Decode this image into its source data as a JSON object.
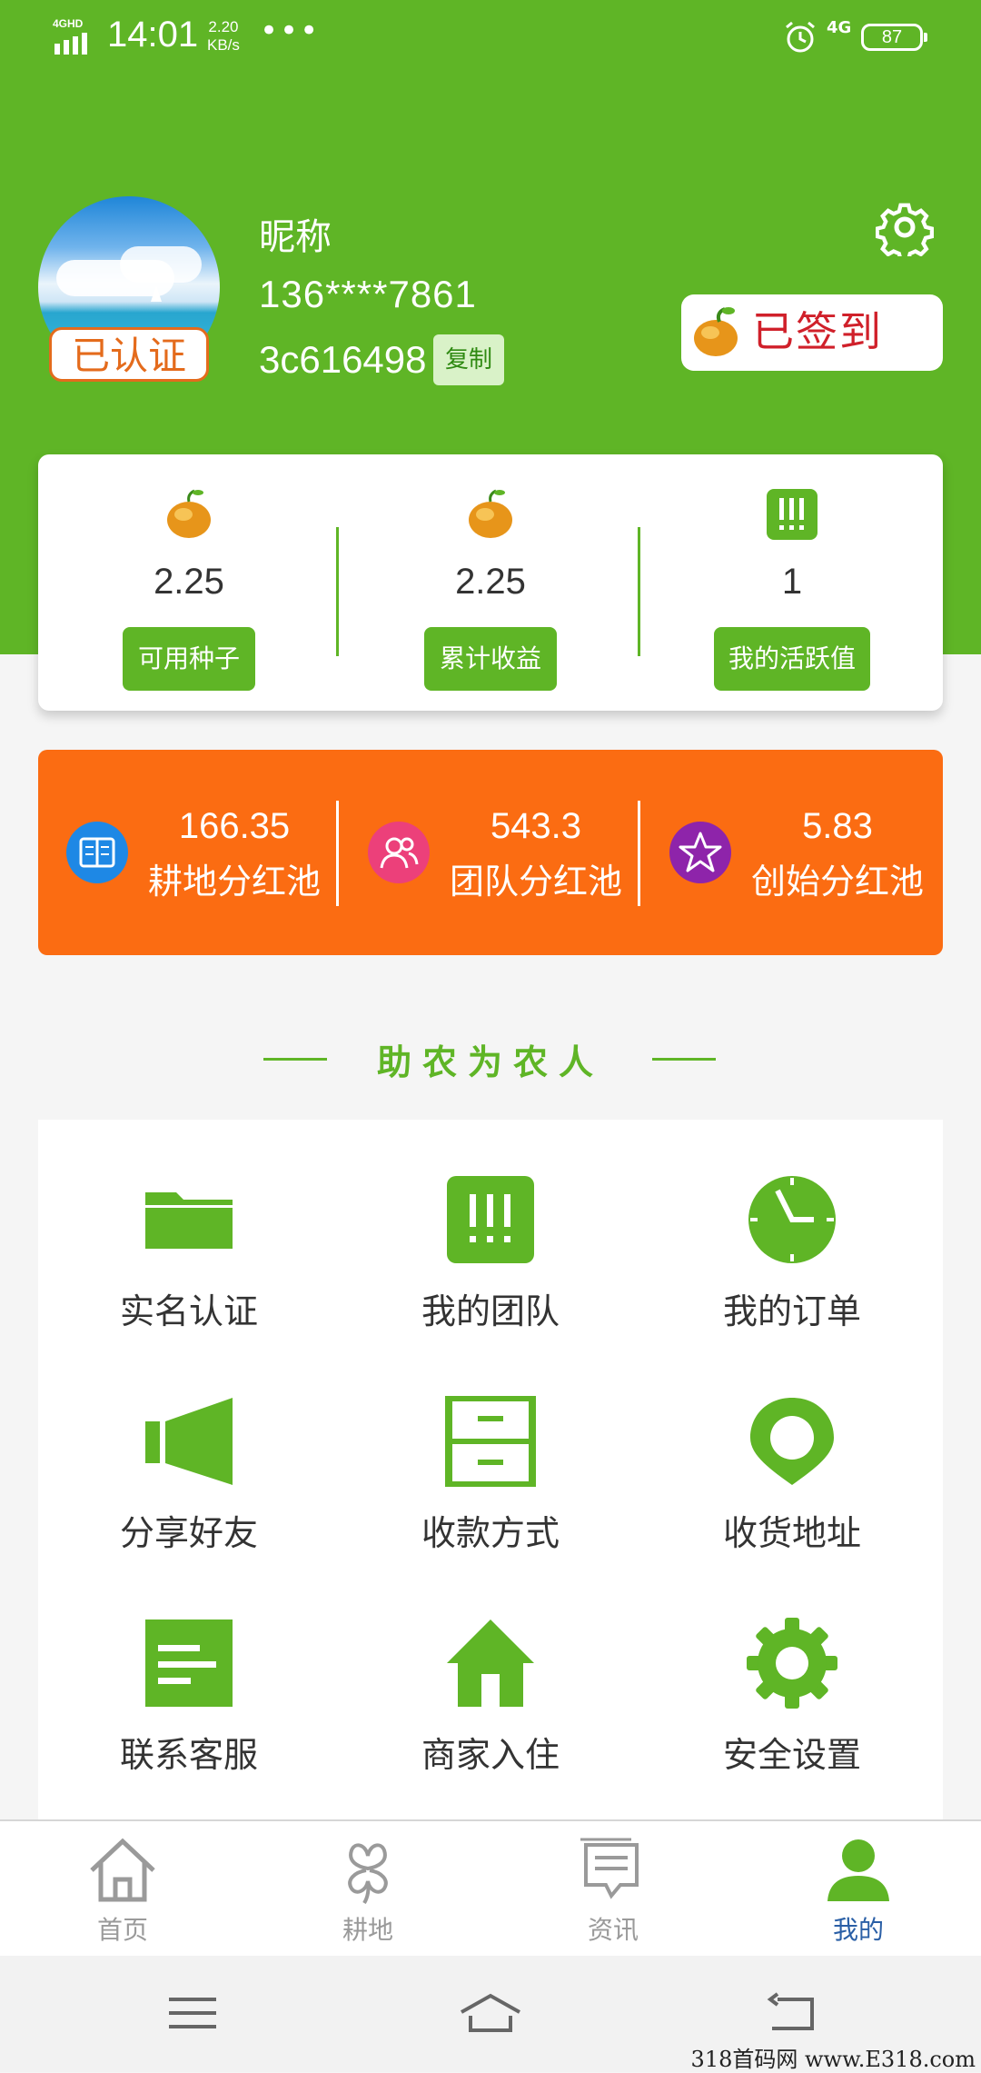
{
  "status_bar": {
    "network": "4GHD",
    "time": "14:01",
    "speed_value": "2.20",
    "speed_unit": "KB/s",
    "more": "•••",
    "network_right": "4G",
    "battery": "87"
  },
  "profile": {
    "verified_badge": "已认证",
    "nickname": "昵称",
    "phone": "136****7861",
    "user_code": "3c616498",
    "copy_label": "复制",
    "signin_label": "已签到"
  },
  "stats": [
    {
      "icon": "bean-icon",
      "value": "2.25",
      "label": "可用种子"
    },
    {
      "icon": "bean-icon",
      "value": "2.25",
      "label": "累计收益"
    },
    {
      "icon": "exclamation-box-icon",
      "value": "1",
      "label": "我的活跃值"
    }
  ],
  "dividend_pools": [
    {
      "icon": "book-icon",
      "value": "166.35",
      "label": "耕地分红池",
      "color": "#1e88e5"
    },
    {
      "icon": "people-icon",
      "value": "543.3",
      "label": "团队分红池",
      "color": "#ec407a"
    },
    {
      "icon": "star-icon",
      "value": "5.83",
      "label": "创始分红池",
      "color": "#8e24aa"
    }
  ],
  "section_title": "助农为农人",
  "menu": [
    {
      "icon": "folder-icon",
      "label": "实名认证"
    },
    {
      "icon": "team-icon",
      "label": "我的团队"
    },
    {
      "icon": "clock-icon",
      "label": "我的订单"
    },
    {
      "icon": "megaphone-icon",
      "label": "分享好友"
    },
    {
      "icon": "cabinet-icon",
      "label": "收款方式"
    },
    {
      "icon": "location-pin-icon",
      "label": "收货地址"
    },
    {
      "icon": "document-icon",
      "label": "联系客服"
    },
    {
      "icon": "home-icon",
      "label": "商家入住"
    },
    {
      "icon": "gear-icon",
      "label": "安全设置"
    }
  ],
  "tabs": [
    {
      "icon": "home-outline-icon",
      "label": "首页",
      "active": false
    },
    {
      "icon": "clover-icon",
      "label": "耕地",
      "active": false
    },
    {
      "icon": "chat-icon",
      "label": "资讯",
      "active": false
    },
    {
      "icon": "user-icon",
      "label": "我的",
      "active": true
    }
  ],
  "watermark": "318首码网 www.E318.com",
  "colors": {
    "brand_green": "#5fb526",
    "orange": "#fb6c12",
    "signin_red": "#d0202a",
    "active_tab": "#2a5fa6"
  }
}
